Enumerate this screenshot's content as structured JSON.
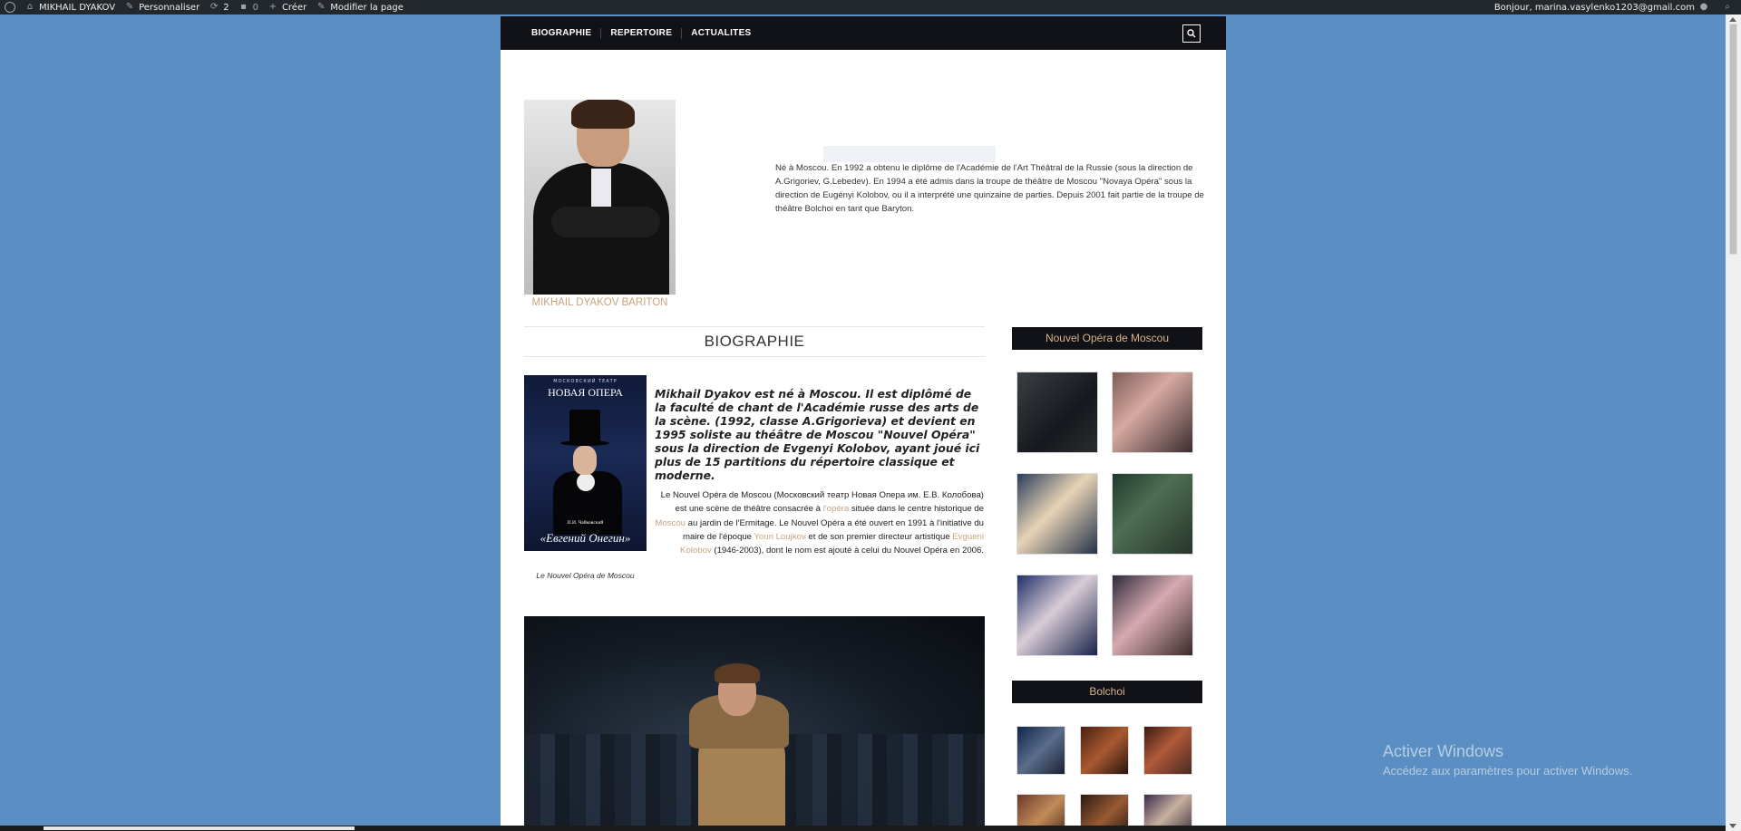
{
  "adminbar": {
    "site_name": "MIKHAIL DYAKOV",
    "customize": "Personnaliser",
    "updates_count": "2",
    "comments_count": "0",
    "new_label": "Créer",
    "edit_page": "Modifier la page",
    "greeting": "Bonjour, marina.vasylenko1203@gmail.com"
  },
  "nav": {
    "items": [
      "BIOGRAPHIE",
      "REPERTOIRE",
      "ACTUALITES"
    ]
  },
  "header": {
    "portrait_caption": "MIKHAIL DYAKOV BARITON",
    "intro": "Né à Moscou. En 1992 a obtenu le diplôme de l'Académie de l'Art Théâtral de la Russie (sous la direction de A.Grigoriev, G.Lebedev). En 1994 a été admis dans la troupe de théâtre de Moscou \"Novaya Opéra\" sous la direction de Eugényi Kolobov, ou il a interprété une quinzaine de parties. Depuis 2001 fait partie de la troupe de théâtre Bolchoi en tant que Baryton."
  },
  "bio": {
    "section_title": "BIOGRAPHIE",
    "lead": "Mikhail Dyakov est né à Moscou. Il est diplômé de la faculté de chant de l'Académie russe des arts de la scène. (1992, classe A.Grigorieva) et devient en 1995 soliste au théâtre de Moscou \"Nouvel Opéra\" sous la direction de Evgenyi Kolobov, ayant joué ici plus de 15 partitions du répertoire classique et moderne.",
    "body_1": "Le Nouvel Opéra de Moscou (Московский театр Новая Опера им. Е.В. Колобова) est une scène de théâtre consacrée à ",
    "link_opera": "l'opéra",
    "body_2": " située dans le centre historique de ",
    "link_moscou": "Moscou",
    "body_3": " au jardin de l'Ermitage. Le Nouvel Opéra a été ouvert en 1991 à l'initiative du maire de l'époque ",
    "link_loujkov": "Youri Loujkov",
    "body_4": " et de son premier directeur artistique ",
    "link_kolobov": "Evgueni Kolobov",
    "body_5": " (1946-2003), dont le nom est ajouté à celui du Nouvel Opéra en 2006.",
    "poster_top": "МОСКОВСКИЙ ТЕАТР",
    "poster_name": "НОВАЯ ОПЕРА",
    "poster_sub": "П.И. Чайковский",
    "poster_title": "«Евгений Онегин»",
    "poster_caption": "Le Nouvel Opéra de Moscou"
  },
  "sidebar": {
    "gallery1_title": "Nouvel Opéra de Moscou",
    "gallery2_title": "Bolchoi"
  },
  "watermark": {
    "line1": "Activer Windows",
    "line2": "Accédez aux paramètres pour activer Windows."
  }
}
